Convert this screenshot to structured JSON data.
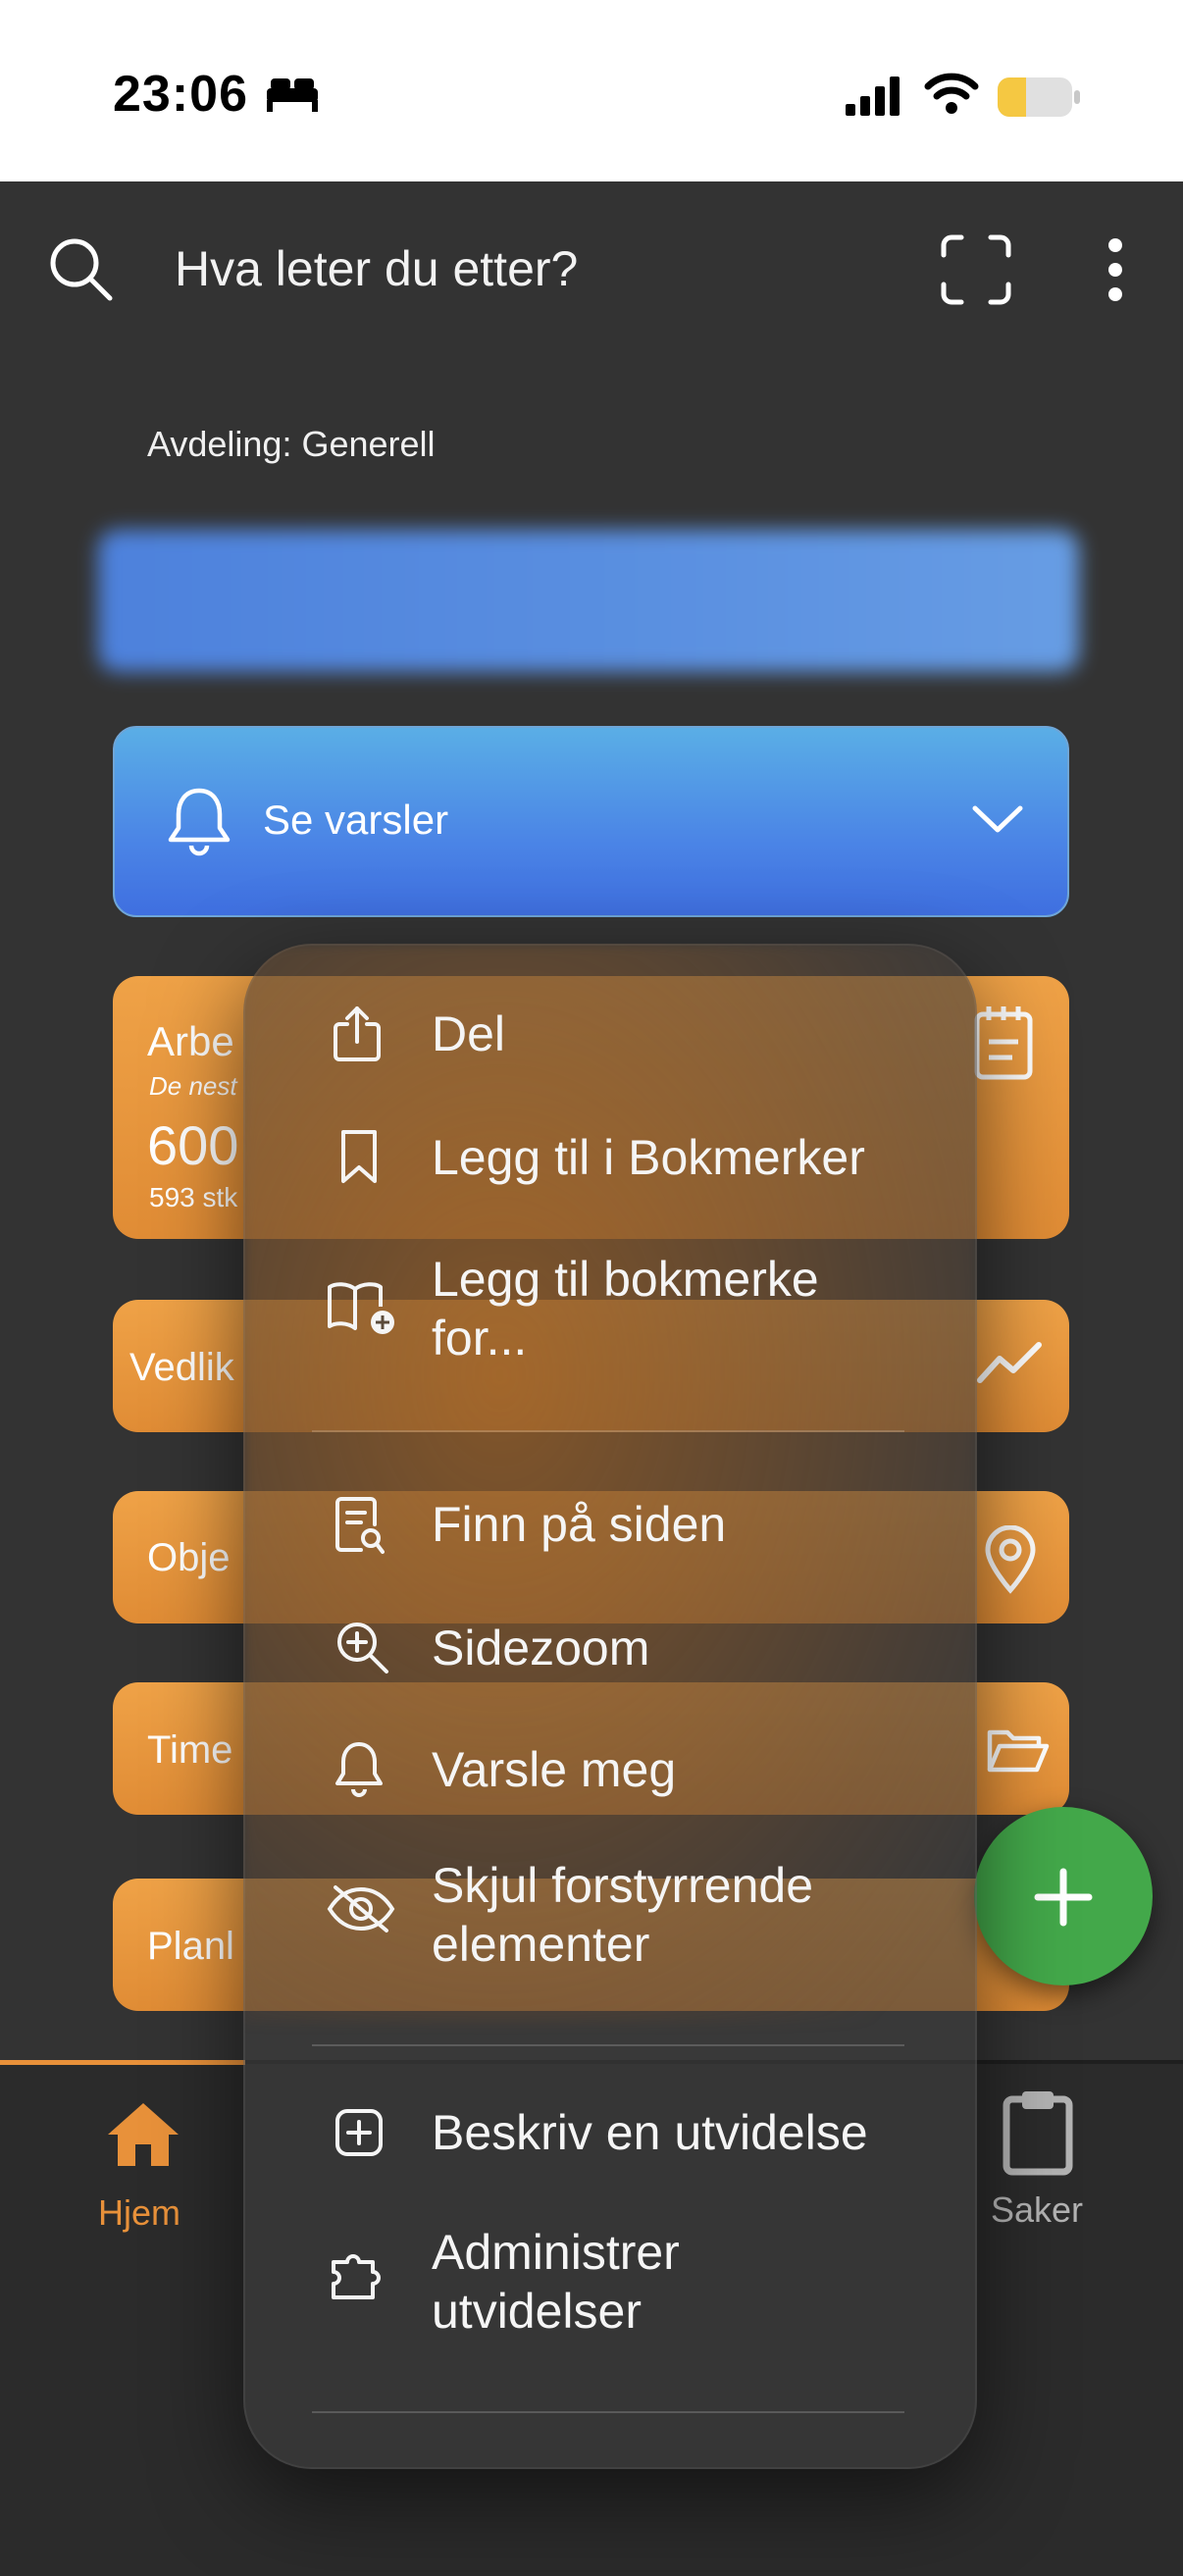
{
  "status_bar": {
    "time": "23:06"
  },
  "search": {
    "placeholder": "Hva leter du etter?"
  },
  "department": "Avdeling: Generell",
  "alerts": {
    "label": "Se varsler"
  },
  "tiles": {
    "work_title": "Arbe",
    "work_sub": "De nest",
    "work_num": "600",
    "work_count": "593 stk",
    "maint_label": "Vedlik",
    "obj_label": "Obje",
    "time_label": "Time",
    "plan_label": "Planl"
  },
  "menu": {
    "items": [
      {
        "label": "Del",
        "icon": "share-icon"
      },
      {
        "label": "Legg til i Bokmerker",
        "icon": "bookmark-icon"
      },
      {
        "label": "Legg til bokmerke\nfor...",
        "icon": "book-add-icon"
      },
      {
        "label": "Finn på siden",
        "icon": "find-page-icon"
      },
      {
        "label": "Sidezoom",
        "icon": "zoom-icon"
      },
      {
        "label": "Varsle meg",
        "icon": "bell-icon"
      },
      {
        "label": "Skjul forstyrrende\nelementer",
        "icon": "eye-off-icon"
      },
      {
        "label": "Beskriv en utvidelse",
        "icon": "plus-square-icon"
      },
      {
        "label": "Administrer\nutvidelser",
        "icon": "puzzle-icon"
      }
    ]
  },
  "bottom_nav": {
    "home_label": "Hjem",
    "cases_label": "Saker"
  },
  "colors": {
    "accent_orange": "#e8913a",
    "alerts_blue": "#4b85e6",
    "fab_green": "#43a84a",
    "background": "#333333"
  }
}
